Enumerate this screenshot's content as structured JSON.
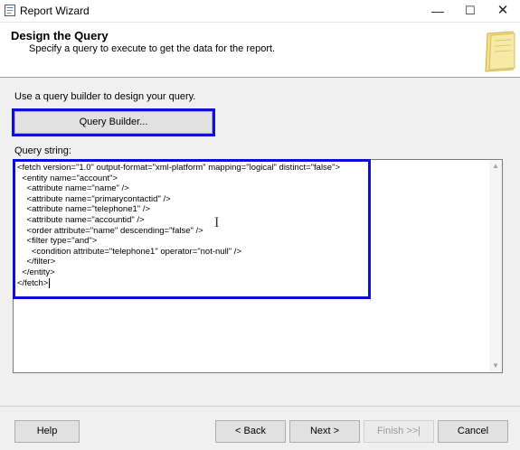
{
  "window": {
    "title": "Report Wizard",
    "controls": {
      "minimize": "—",
      "maximize": "☐",
      "close": "✕"
    }
  },
  "header": {
    "title": "Design the Query",
    "subtitle": "Specify a query to execute to get the data for the report."
  },
  "query_builder": {
    "instruction": "Use a query builder to design your query.",
    "button_label": "Query Builder..."
  },
  "query": {
    "label": "Query string:",
    "text": "<fetch version=\"1.0\" output-format=\"xml-platform\" mapping=\"logical\" distinct=\"false\">\n  <entity name=\"account\">\n    <attribute name=\"name\" />\n    <attribute name=\"primarycontactid\" />\n    <attribute name=\"telephone1\" />\n    <attribute name=\"accountid\" />\n    <order attribute=\"name\" descending=\"false\" />\n    <filter type=\"and\">\n      <condition attribute=\"telephone1\" operator=\"not-null\" />\n    </filter>\n  </entity>\n</fetch>"
  },
  "buttons": {
    "help": "Help",
    "back": "< Back",
    "next": "Next >",
    "finish": "Finish >>|",
    "cancel": "Cancel",
    "finish_enabled": false
  },
  "colors": {
    "highlight": "#1010d0",
    "window_bg": "#f0f0f0"
  }
}
